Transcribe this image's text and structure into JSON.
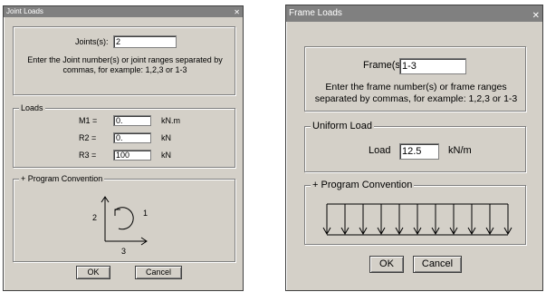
{
  "joint_dialog": {
    "title": "Joint Loads",
    "close_glyph": "✕",
    "joints_label": "Joints(s):",
    "joints_value": "2",
    "instructions": "Enter the Joint number(s) or joint ranges separated by commas, for example: 1,2,3 or 1-3",
    "loads_legend": "Loads",
    "rows": [
      {
        "label": "M1 =",
        "value": "0.",
        "unit": "kN.m"
      },
      {
        "label": "R2 =",
        "value": "0.",
        "unit": "kN"
      },
      {
        "label": "R3 =",
        "value": "100",
        "unit": "kN"
      }
    ],
    "convention_legend": "+ Program Convention",
    "axis_labels": {
      "a1": "1",
      "a2": "2",
      "a3": "3"
    },
    "ok_label": "OK",
    "cancel_label": "Cancel"
  },
  "frame_dialog": {
    "title": "Frame Loads",
    "close_glyph": "✕",
    "frames_label": "Frame(s)",
    "frames_value": "1-3",
    "instructions": "Enter the frame number(s) or frame ranges separated by commas, for example: 1,2,3 or 1-3",
    "uniform_legend": "Uniform Load",
    "load_label": "Load",
    "load_value": "12.5",
    "load_unit": "kN/m",
    "convention_legend": "+ Program Convention",
    "ok_label": "OK",
    "cancel_label": "Cancel"
  }
}
